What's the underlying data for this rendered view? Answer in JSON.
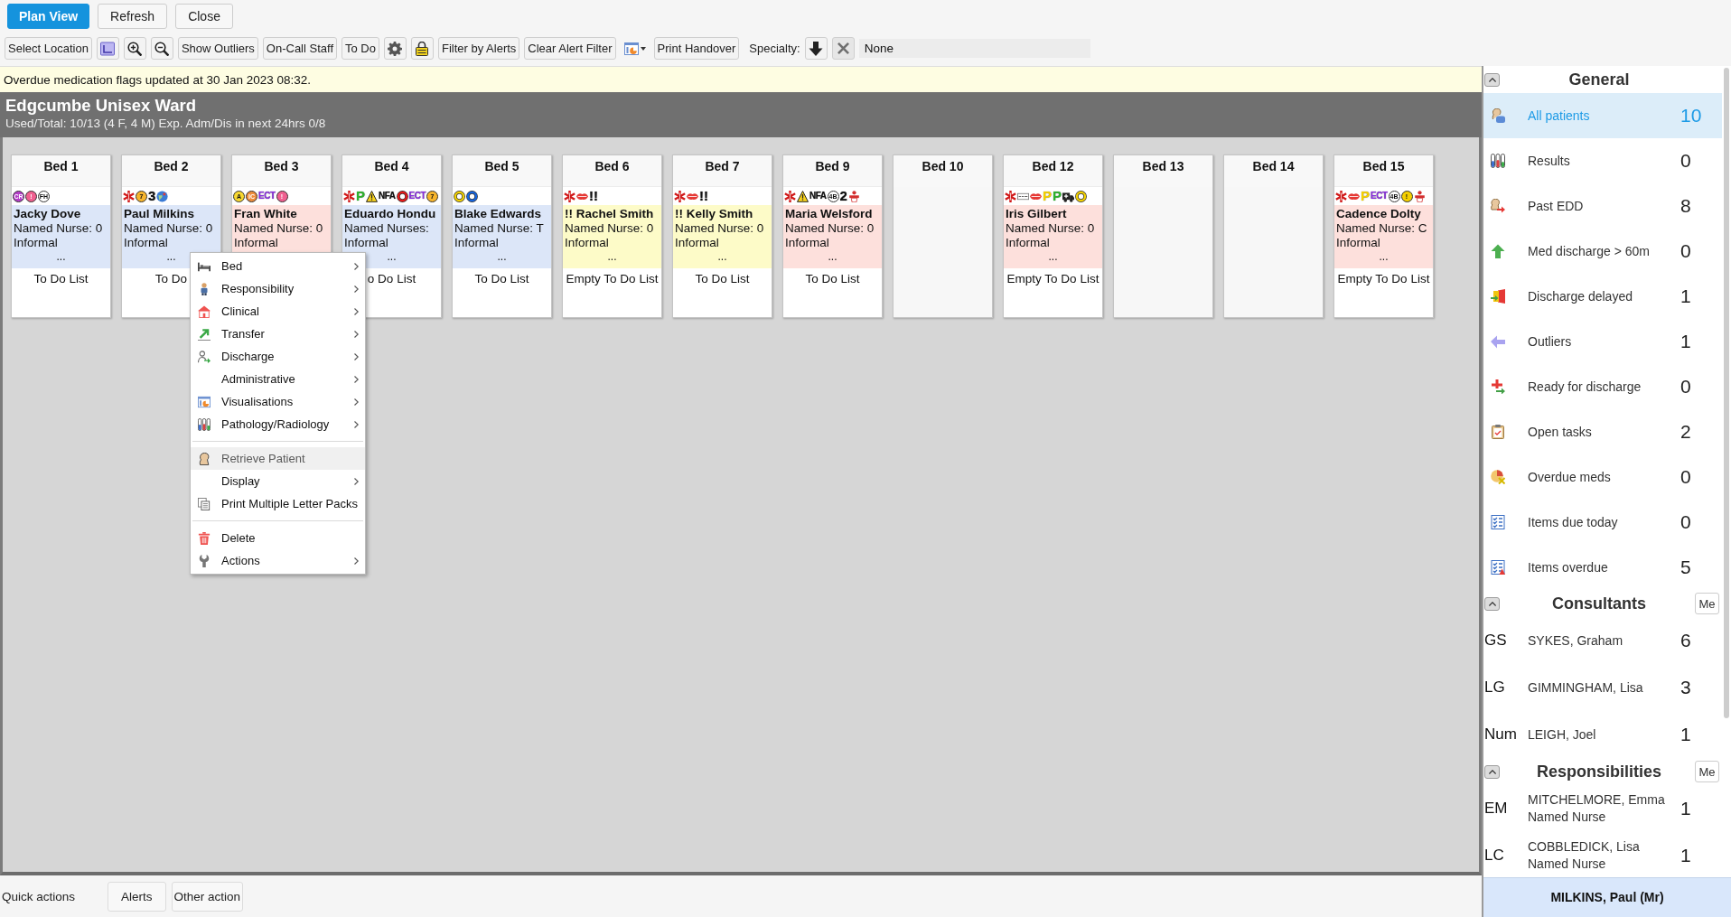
{
  "toolbar": {
    "actions": [
      {
        "label": "Plan View",
        "kind": "primary"
      },
      {
        "label": "Refresh",
        "kind": "default"
      },
      {
        "label": "Close",
        "kind": "default"
      }
    ],
    "tools": [
      {
        "kind": "text",
        "label": "Select Location"
      },
      {
        "kind": "layout"
      },
      {
        "kind": "zoomin"
      },
      {
        "kind": "zoomout"
      },
      {
        "kind": "text",
        "label": "Show Outliers"
      },
      {
        "kind": "text",
        "label": "On-Call Staff"
      },
      {
        "kind": "text",
        "label": "To Do"
      },
      {
        "kind": "gear"
      },
      {
        "kind": "lock"
      },
      {
        "kind": "text",
        "label": "Filter by Alerts"
      },
      {
        "kind": "text",
        "label": "Clear Alert Filter"
      },
      {
        "kind": "chartmenu"
      },
      {
        "kind": "text",
        "label": "Print Handover"
      }
    ],
    "specialty": {
      "label": "Specialty:",
      "value": "None"
    }
  },
  "notice": "Overdue medication flags updated at 30 Jan 2023 08:32.",
  "ward": {
    "title": "Edgcumbe Unisex Ward",
    "summary": "Used/Total: 10/13 (4 F, 4 M) Exp. Adm/Dis in next 24hrs 0/8"
  },
  "beds": [
    {
      "label": "Bed 1",
      "alerts": [
        {
          "kind": "badge",
          "label": "CR",
          "color": "#b43cc8"
        },
        {
          "kind": "badge",
          "label": "!",
          "color": "#f06090"
        },
        {
          "kind": "badge",
          "label": "FH",
          "color": "#ffffff"
        }
      ],
      "patient": {
        "name": "Jacky Dove",
        "nurse": "Named Nurse: 0",
        "status": "Informal",
        "more": "...",
        "color": "#dce6f8"
      },
      "todo": "To Do List"
    },
    {
      "label": "Bed 2",
      "alerts": [
        {
          "kind": "star"
        },
        {
          "kind": "badge",
          "label": "7",
          "color": "#f7b52c"
        },
        {
          "kind": "code",
          "label": "3",
          "color": "#111111"
        },
        {
          "kind": "globe"
        }
      ],
      "patient": {
        "name": "Paul Milkins",
        "nurse": "Named Nurse: 0",
        "status": "Informal",
        "more": "...",
        "color": "#dce6f8"
      },
      "todo": "To Do"
    },
    {
      "label": "Bed 3",
      "alerts": [
        {
          "kind": "badge",
          "label": "A",
          "color": "#f8d830"
        },
        {
          "kind": "badge",
          "label": "IC",
          "color": "#ee8c3a"
        },
        {
          "kind": "code",
          "label": "ECT",
          "color": "#8a2be2"
        },
        {
          "kind": "badge",
          "label": "!",
          "color": "#f06090"
        }
      ],
      "patient": {
        "name": "Fran White",
        "nurse": "Named Nurse: 0",
        "status": "Informal",
        "color": "#fde0dc"
      }
    },
    {
      "label": "Bed 4",
      "alerts": [
        {
          "kind": "star"
        },
        {
          "kind": "code",
          "label": "P",
          "color": "#2db32d"
        },
        {
          "kind": "warning"
        },
        {
          "kind": "code",
          "label": "NFA",
          "color": "#111111"
        },
        {
          "kind": "ring",
          "color": "#e81818"
        },
        {
          "kind": "code",
          "label": "ECT",
          "color": "#8a2be2"
        },
        {
          "kind": "badge",
          "label": "7",
          "color": "#f7b52c"
        }
      ],
      "patient": {
        "name": "Eduardo Hondu",
        "nurse": "Named Nurses:",
        "status": "Informal",
        "more": "...",
        "color": "#dce6f8"
      },
      "todo": "o Do List"
    },
    {
      "label": "Bed 5",
      "alerts": [
        {
          "kind": "ring",
          "color": "#f5d300"
        },
        {
          "kind": "ring",
          "color": "#1565e0"
        }
      ],
      "patient": {
        "name": "Blake Edwards",
        "nurse": "Named Nurse: T",
        "status": "Informal",
        "more": "...",
        "color": "#dce6f8"
      },
      "todo": "To Do List"
    },
    {
      "label": "Bed 6",
      "alerts": [
        {
          "kind": "star"
        },
        {
          "kind": "lips"
        },
        {
          "kind": "code",
          "label": "!!",
          "color": "#111111"
        }
      ],
      "patient": {
        "name": "!! Rachel Smith",
        "nurse": "Named Nurse: 0",
        "status": "Informal",
        "more": "...",
        "color": "#fdfbc8"
      },
      "todo": "Empty To Do List"
    },
    {
      "label": "Bed 7",
      "alerts": [
        {
          "kind": "star"
        },
        {
          "kind": "lips"
        },
        {
          "kind": "code",
          "label": "!!",
          "color": "#111111"
        }
      ],
      "patient": {
        "name": "!! Kelly Smith",
        "nurse": "Named Nurse: 0",
        "status": "Informal",
        "more": "...",
        "color": "#fdfbc8"
      },
      "todo": "To Do List"
    },
    {
      "label": "Bed 9",
      "alerts": [
        {
          "kind": "star"
        },
        {
          "kind": "warning"
        },
        {
          "kind": "code",
          "label": "NFA",
          "color": "#111111"
        },
        {
          "kind": "badge",
          "label": "4B",
          "color": "#ffffff"
        },
        {
          "kind": "code",
          "label": "2",
          "color": "#111111"
        },
        {
          "kind": "figure"
        }
      ],
      "patient": {
        "name": "Maria Welsford",
        "nurse": "Named Nurse: 0",
        "status": "Informal",
        "more": "...",
        "color": "#fde0dc"
      },
      "todo": "To Do List"
    },
    {
      "label": "Bed 10"
    },
    {
      "label": "Bed 12",
      "alerts": [
        {
          "kind": "star"
        },
        {
          "kind": "tag"
        },
        {
          "kind": "lips"
        },
        {
          "kind": "code",
          "label": "P",
          "color": "#f5d000"
        },
        {
          "kind": "code",
          "label": "P",
          "color": "#2db32d"
        },
        {
          "kind": "van"
        },
        {
          "kind": "ring",
          "color": "#f5d300"
        }
      ],
      "patient": {
        "name": "Iris Gilbert",
        "nurse": "Named Nurse: 0",
        "status": "Informal",
        "more": "...",
        "color": "#fde0dc"
      },
      "todo": "Empty To Do List"
    },
    {
      "label": "Bed 13"
    },
    {
      "label": "Bed 14"
    },
    {
      "label": "Bed 15",
      "alerts": [
        {
          "kind": "star"
        },
        {
          "kind": "lips"
        },
        {
          "kind": "code",
          "label": "P",
          "color": "#f5d000"
        },
        {
          "kind": "code",
          "label": "ECT",
          "color": "#8a2be2"
        },
        {
          "kind": "badge",
          "label": "4B",
          "color": "#ffffff"
        },
        {
          "kind": "badge",
          "label": "!",
          "color": "#f5d000"
        },
        {
          "kind": "figure"
        }
      ],
      "patient": {
        "name": "Cadence Dolty",
        "nurse": "Named Nurse: C",
        "status": "Informal",
        "more": "...",
        "color": "#fde0dc"
      },
      "todo": "Empty To Do List"
    }
  ],
  "context_menu": {
    "items": [
      {
        "kind": "bed",
        "label": "Bed",
        "submenu": true,
        "highlighted": false
      },
      {
        "kind": "person",
        "label": "Responsibility",
        "submenu": true,
        "highlighted": false
      },
      {
        "kind": "house",
        "label": "Clinical",
        "submenu": true,
        "highlighted": false
      },
      {
        "kind": "transfer",
        "label": "Transfer",
        "submenu": true,
        "highlighted": false
      },
      {
        "kind": "discharge",
        "label": "Discharge",
        "submenu": true,
        "highlighted": false
      },
      {
        "kind": "plain",
        "label": "Administrative",
        "submenu": true,
        "highlighted": false
      },
      {
        "kind": "chart",
        "label": "Visualisations",
        "submenu": true,
        "highlighted": false
      },
      {
        "kind": "tubes",
        "label": "Pathology/Radiology",
        "submenu": true,
        "highlighted": false
      },
      {
        "kind": "separator"
      },
      {
        "kind": "head",
        "label": "Retrieve Patient",
        "submenu": false,
        "highlighted": true
      },
      {
        "kind": "plain",
        "label": "Display",
        "submenu": true,
        "highlighted": false
      },
      {
        "kind": "copies",
        "label": "Print Multiple Letter Packs",
        "submenu": false,
        "highlighted": false
      },
      {
        "kind": "separator"
      },
      {
        "kind": "trash",
        "label": "Delete",
        "submenu": false,
        "highlighted": false
      },
      {
        "kind": "wrench",
        "label": "Actions",
        "submenu": true,
        "highlighted": false
      }
    ]
  },
  "sidebar": {
    "sections": [
      {
        "title": "General",
        "expanded": true,
        "items": [
          {
            "kind": "patients",
            "label": "All patients",
            "count": "10",
            "selected": true
          },
          {
            "kind": "tubes",
            "label": "Results",
            "count": "0",
            "selected": false
          },
          {
            "kind": "pastedd",
            "label": "Past EDD",
            "count": "8",
            "selected": false
          },
          {
            "kind": "uparrow",
            "label": "Med discharge > 60m",
            "count": "0",
            "selected": false
          },
          {
            "kind": "door",
            "label": "Discharge delayed",
            "count": "1",
            "selected": false
          },
          {
            "kind": "leftarrow",
            "label": "Outliers",
            "count": "1",
            "selected": false
          },
          {
            "kind": "crossarrow",
            "label": "Ready for discharge",
            "count": "0",
            "selected": false
          },
          {
            "kind": "clipboard",
            "label": "Open tasks",
            "count": "2",
            "selected": false
          },
          {
            "kind": "piecross",
            "label": "Overdue meds",
            "count": "0",
            "selected": false
          },
          {
            "kind": "checklist",
            "label": "Items due today",
            "count": "0",
            "selected": false
          },
          {
            "kind": "checkwarn",
            "label": "Items overdue",
            "count": "5",
            "selected": false
          }
        ]
      },
      {
        "title": "Consultants",
        "expanded": true,
        "me_button": "Me",
        "items": [
          {
            "initials": "GS",
            "label": "SYKES, Graham",
            "count": "6",
            "selected": false
          },
          {
            "initials": "LG",
            "label": "GIMMINGHAM, Lisa",
            "count": "3",
            "selected": false
          },
          {
            "initials": "Num",
            "label": "LEIGH, Joel",
            "count": "1",
            "selected": false
          }
        ]
      },
      {
        "title": "Responsibilities",
        "expanded": true,
        "me_button": "Me",
        "items": [
          {
            "initials": "EM",
            "label": "MITCHELMORE, Emma",
            "role": "Named Nurse",
            "count": "1",
            "selected": false
          },
          {
            "initials": "LC",
            "label": "COBBLEDICK, Lisa",
            "role": "Named Nurse",
            "count": "1",
            "selected": false
          }
        ]
      }
    ]
  },
  "quick_actions": {
    "label": "Quick actions",
    "buttons": [
      "Alerts",
      "Other action"
    ]
  },
  "selected_patient": "MILKINS, Paul (Mr)"
}
